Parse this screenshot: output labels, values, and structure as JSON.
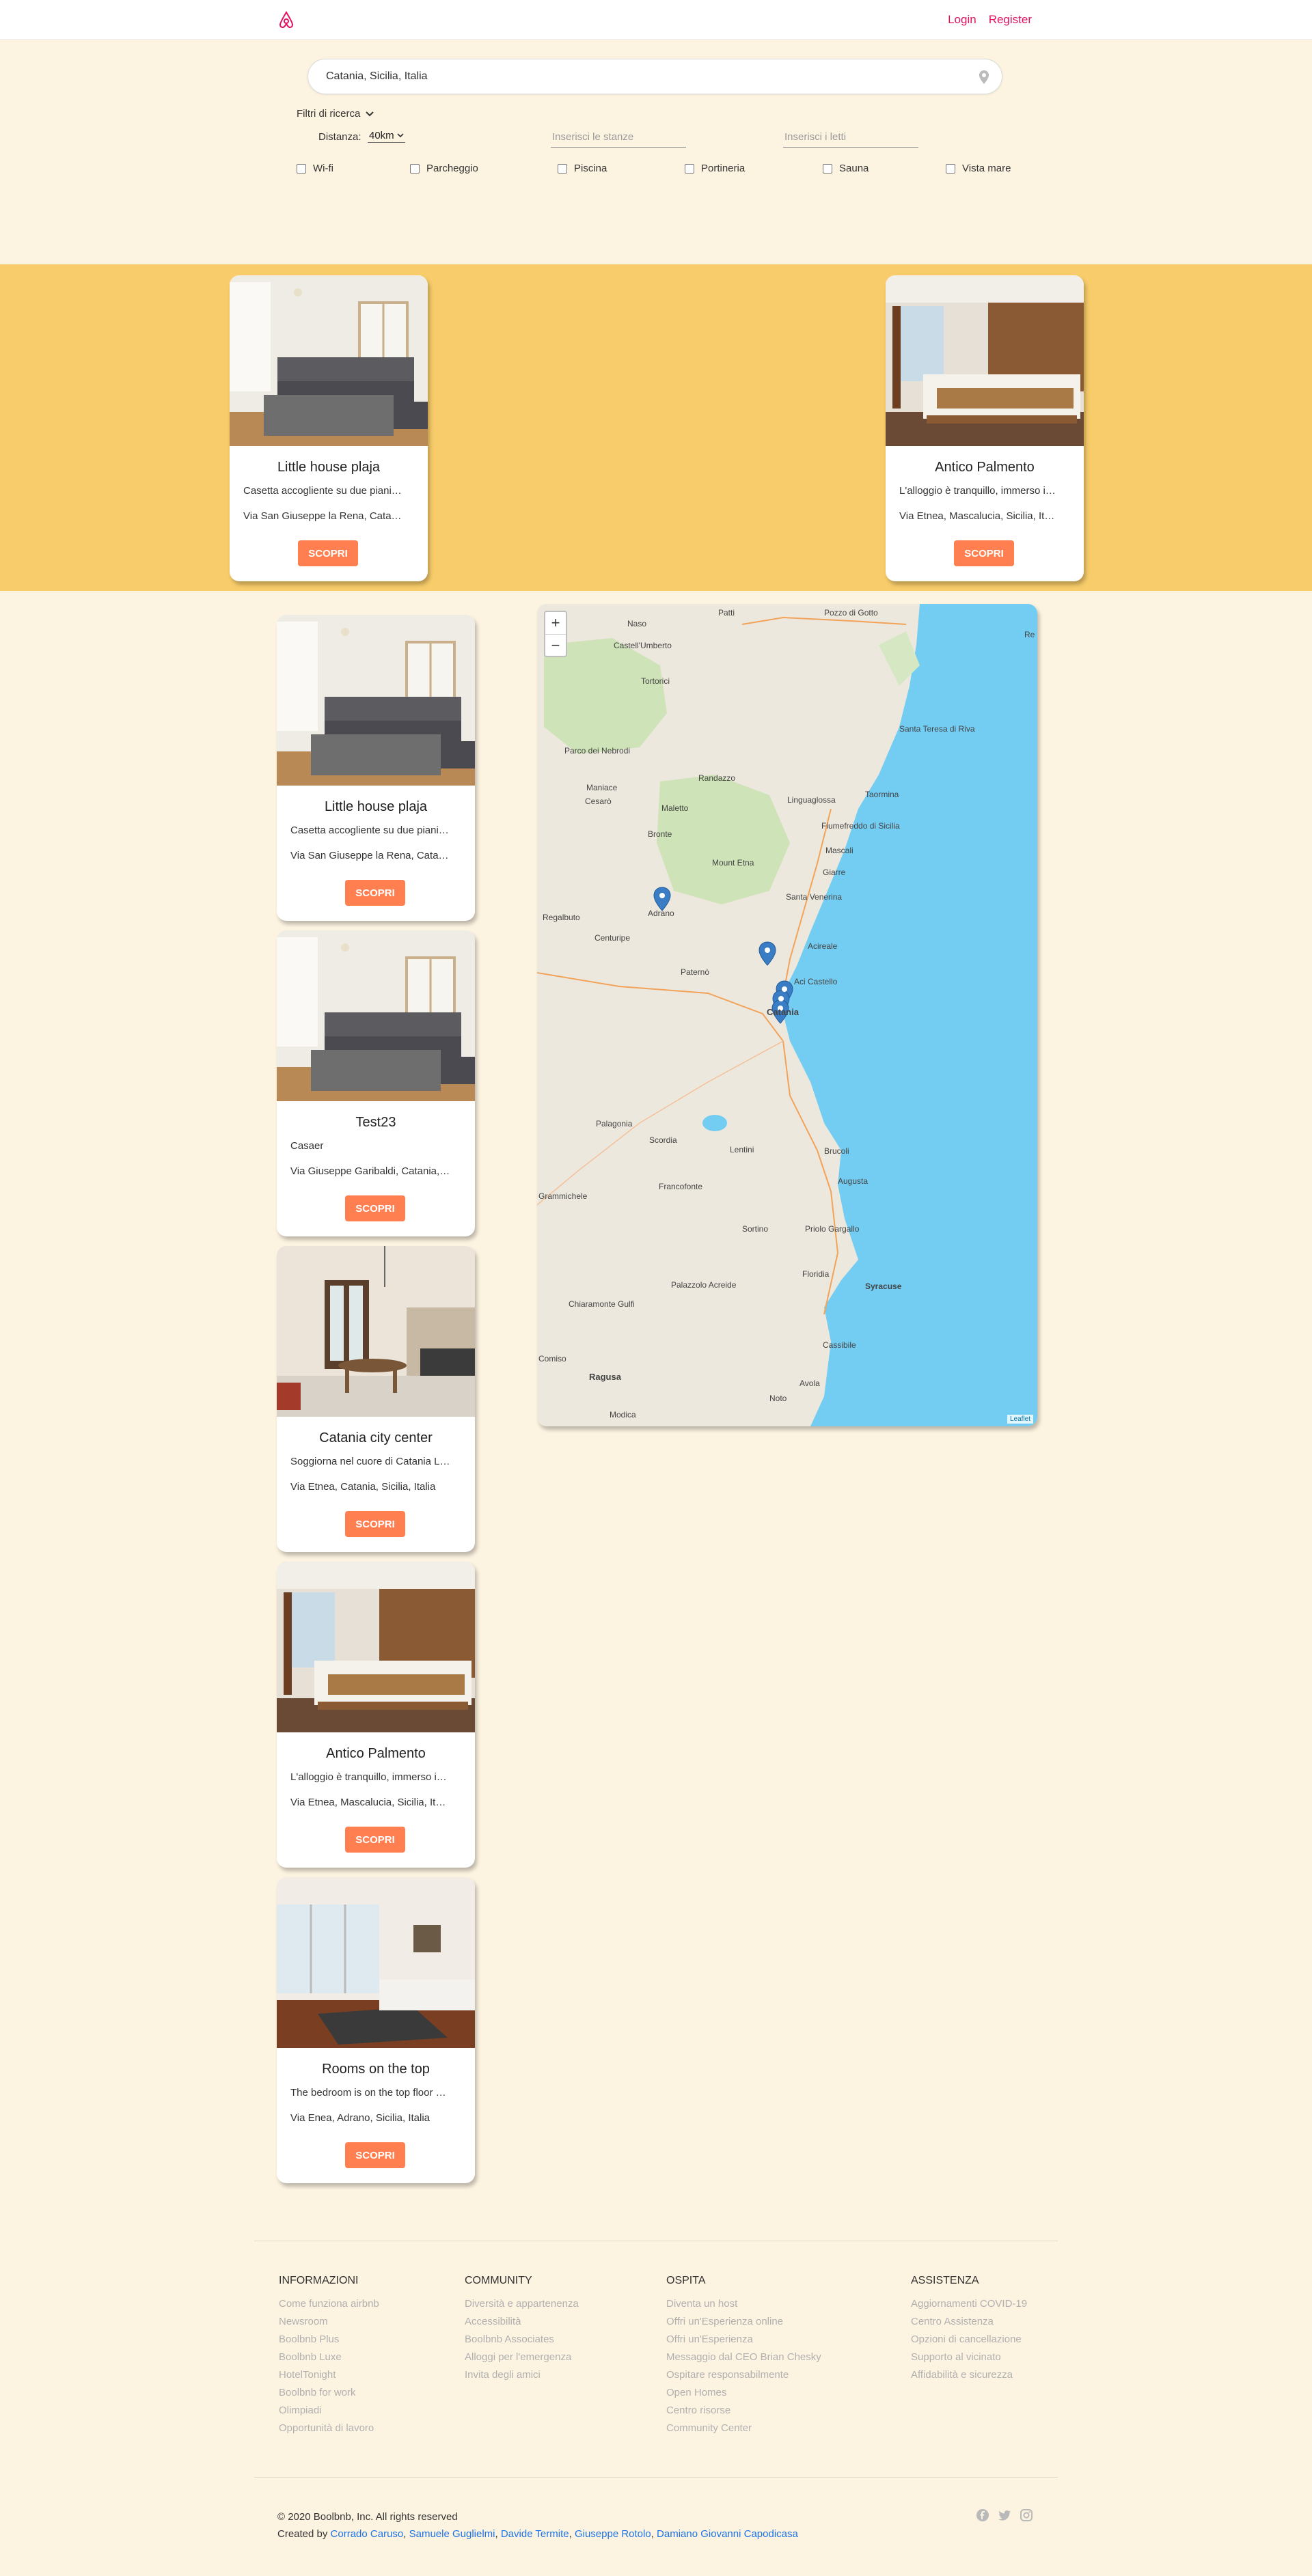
{
  "header": {
    "login": "Login",
    "register": "Register",
    "logo_icon": "airbnb-logo-icon"
  },
  "search": {
    "value": "Catania, Sicilia, Italia",
    "icon": "map-pin-icon"
  },
  "filters": {
    "toggle_label": "Filtri di ricerca",
    "distance_label": "Distanza:",
    "distance_value": "40km",
    "rooms_placeholder": "Inserisci le stanze",
    "beds_placeholder": "Inserisci i letti",
    "amenities": [
      "Wi-fi",
      "Parcheggio",
      "Piscina",
      "Portineria",
      "Sauna",
      "Vista mare"
    ]
  },
  "colors": {
    "accent": "#ff7f50",
    "brand": "#e0115f",
    "band": "#f8cc6a",
    "page": "#fdf3e1",
    "sea": "#73cdf2"
  },
  "featured": [
    {
      "title": "Little house plaja",
      "desc": "Casetta accogliente su due piani…",
      "addr": "Via San Giuseppe la Rena, Cata…",
      "button": "SCOPRI"
    },
    {
      "title": "Antico Palmento",
      "desc": "L'alloggio è tranquillo, immerso i…",
      "addr": "Via Etnea, Mascalucia, Sicilia, It…",
      "button": "SCOPRI"
    }
  ],
  "listings": [
    {
      "title": "Little house plaja",
      "desc": "Casetta accogliente su due piani…",
      "addr": "Via San Giuseppe la Rena, Cata…",
      "button": "SCOPRI"
    },
    {
      "title": "Test23",
      "desc": "Casaer",
      "addr": "Via Giuseppe Garibaldi, Catania,…",
      "button": "SCOPRI"
    },
    {
      "title": "Catania city center",
      "desc": "Soggiorna nel cuore di Catania L…",
      "addr": "Via Etnea, Catania, Sicilia, Italia",
      "button": "SCOPRI"
    },
    {
      "title": "Antico Palmento",
      "desc": "L'alloggio è tranquillo, immerso i…",
      "addr": "Via Etnea, Mascalucia, Sicilia, It…",
      "button": "SCOPRI"
    },
    {
      "title": "Rooms on the top",
      "desc": "The bedroom is on the top floor …",
      "addr": "Via Enea, Adrano, Sicilia, Italia",
      "button": "SCOPRI"
    }
  ],
  "map": {
    "zoom_in": "+",
    "zoom_out": "−",
    "attribution": "Leaflet",
    "labels": [
      "Patti",
      "Pozzo di Gotto",
      "Naso",
      "Castell'Umberto",
      "Tortorici",
      "Parco dei Nebrodi",
      "Randazzo",
      "Maniace",
      "Cesarò",
      "Maletto",
      "Linguaglossa",
      "Taormina",
      "Santa Teresa di Riva",
      "Fiumefreddo di Sicilia",
      "Mascali",
      "Bronte",
      "Mount Etna",
      "Giarre",
      "Adrano",
      "Santa Venerina",
      "Acireale",
      "Centuripe",
      "Regalbuto",
      "Paternò",
      "Aci Castello",
      "Catania",
      "Palagonia",
      "Scordia",
      "Lentini",
      "Brucoli",
      "Augusta",
      "Francofonte",
      "Grammichele",
      "Sortino",
      "Priolo Gargallo",
      "Floridia",
      "Syracuse",
      "Palazzolo Acreide",
      "Chiaramonte Gulfi",
      "Cassibile",
      "Comiso",
      "Ragusa",
      "Avola",
      "Noto",
      "Modica",
      "Re"
    ]
  },
  "footer": {
    "columns": [
      {
        "title": "INFORMAZIONI",
        "items": [
          "Come funziona airbnb",
          "Newsroom",
          "Boolbnb Plus",
          "Boolbnb Luxe",
          "HotelTonight",
          "Boolbnb for work",
          "Olimpiadi",
          "Opportunità di lavoro"
        ]
      },
      {
        "title": "COMMUNITY",
        "items": [
          "Diversità e appartenenza",
          "Accessibilità",
          "Boolbnb Associates",
          "Alloggi per l'emergenza",
          "Invita degli amici"
        ]
      },
      {
        "title": "OSPITA",
        "items": [
          "Diventa un host",
          "Offri un'Esperienza online",
          "Offri un'Esperienza",
          "Messaggio dal CEO Brian Chesky",
          "Ospitare responsabilmente",
          "Open Homes",
          "Centro risorse",
          "Community Center"
        ]
      },
      {
        "title": "ASSISTENZA",
        "items": [
          "Aggiornamenti COVID-19",
          "Centro Assistenza",
          "Opzioni di cancellazione",
          "Supporto al vicinato",
          "Affidabilità e sicurezza"
        ]
      }
    ],
    "copyright": "© 2020 Boolbnb, Inc. All rights reserved",
    "created_by": "Created by",
    "authors": [
      "Corrado Caruso",
      "Samuele Guglielmi",
      "Davide Termite",
      "Giuseppe Rotolo",
      "Damiano Giovanni Capodicasa"
    ],
    "social_icons": [
      "facebook-icon",
      "twitter-icon",
      "instagram-icon"
    ]
  }
}
